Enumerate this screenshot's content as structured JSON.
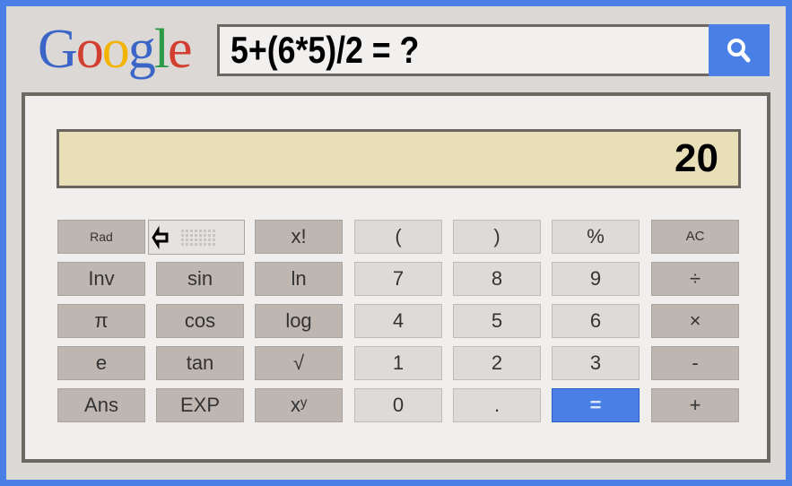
{
  "logo": {
    "letters": [
      {
        "c": "G",
        "color": "#3b66c8"
      },
      {
        "c": "o",
        "color": "#d23f31"
      },
      {
        "c": "o",
        "color": "#f2b400"
      },
      {
        "c": "g",
        "color": "#3b66c8"
      },
      {
        "c": "l",
        "color": "#2a9a44"
      },
      {
        "c": "e",
        "color": "#d23f31"
      }
    ]
  },
  "search": {
    "query": "5+(6*5)/2 = ?",
    "icon": "search-icon"
  },
  "display": {
    "value": "20"
  },
  "buttons": [
    [
      {
        "l": "Rad",
        "k": "f",
        "s": 14
      },
      {
        "l": "",
        "k": "deg"
      },
      {
        "l": "x!",
        "k": "f"
      },
      {
        "l": "(",
        "k": "n"
      },
      {
        "l": ")",
        "k": "n"
      },
      {
        "l": "%",
        "k": "n"
      },
      {
        "l": "AC",
        "k": "f",
        "s": 15
      }
    ],
    [
      {
        "l": "Inv",
        "k": "f"
      },
      {
        "l": "sin",
        "k": "f"
      },
      {
        "l": "ln",
        "k": "f"
      },
      {
        "l": "7",
        "k": "n"
      },
      {
        "l": "8",
        "k": "n"
      },
      {
        "l": "9",
        "k": "n"
      },
      {
        "l": "÷",
        "k": "f"
      }
    ],
    [
      {
        "l": "π",
        "k": "f"
      },
      {
        "l": "cos",
        "k": "f"
      },
      {
        "l": "log",
        "k": "f"
      },
      {
        "l": "4",
        "k": "n"
      },
      {
        "l": "5",
        "k": "n"
      },
      {
        "l": "6",
        "k": "n"
      },
      {
        "l": "×",
        "k": "f"
      }
    ],
    [
      {
        "l": "e",
        "k": "f"
      },
      {
        "l": "tan",
        "k": "f"
      },
      {
        "l": "√",
        "k": "f"
      },
      {
        "l": "1",
        "k": "n"
      },
      {
        "l": "2",
        "k": "n"
      },
      {
        "l": "3",
        "k": "n"
      },
      {
        "l": "-",
        "k": "f"
      }
    ],
    [
      {
        "l": "Ans",
        "k": "f"
      },
      {
        "l": "EXP",
        "k": "f"
      },
      {
        "l": "xʸ",
        "k": "f"
      },
      {
        "l": "0",
        "k": "n"
      },
      {
        "l": ".",
        "k": "n"
      },
      {
        "l": "=",
        "k": "eq"
      },
      {
        "l": "+",
        "k": "f"
      }
    ]
  ]
}
